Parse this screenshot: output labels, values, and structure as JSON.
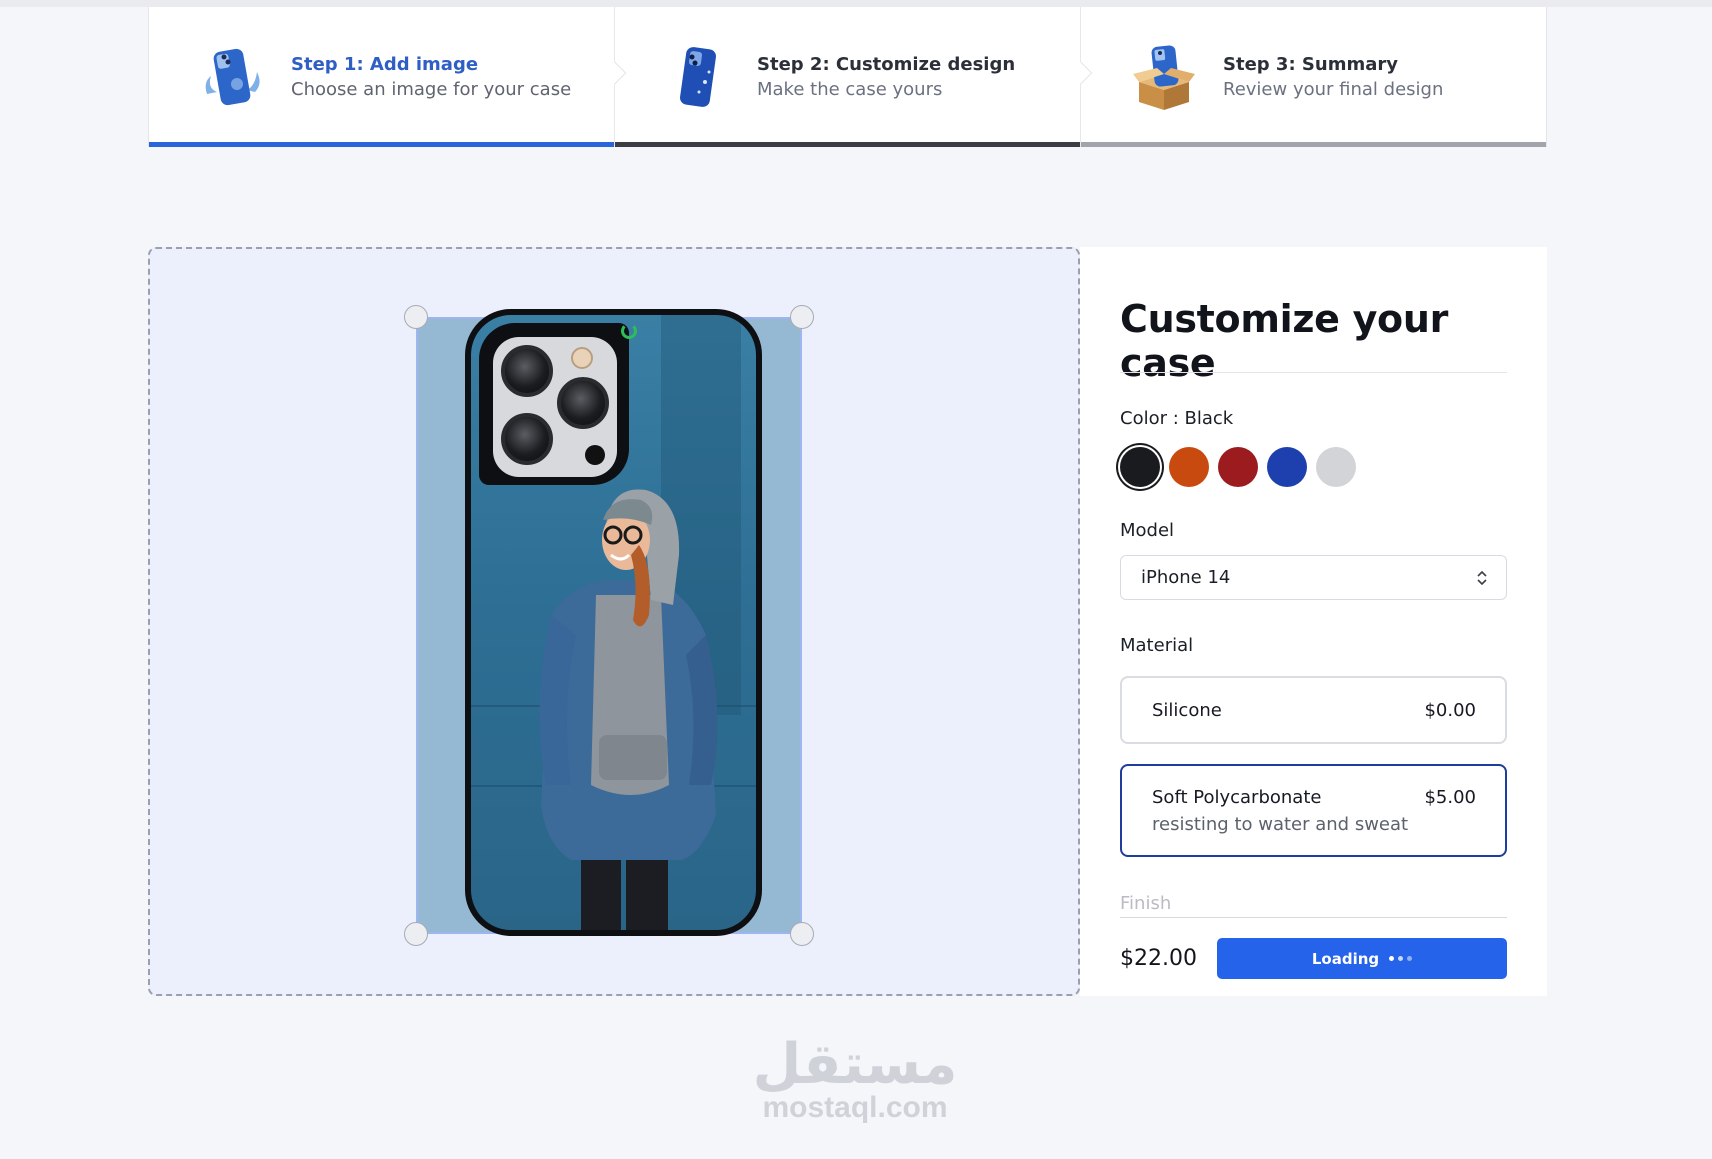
{
  "steps": [
    {
      "title": "Step 1: Add image",
      "subtitle": "Choose an image for your case",
      "state": "active",
      "bar_color": "#2b63d9",
      "icon": "phone-case-splash-icon"
    },
    {
      "title": "Step 2: Customize design",
      "subtitle": "Make the case yours",
      "state": "current",
      "bar_color": "#3a3d44",
      "icon": "phone-case-sparkle-icon"
    },
    {
      "title": "Step 3: Summary",
      "subtitle": "Review your final design",
      "state": "upcoming",
      "bar_color": "#a1a4aa",
      "icon": "phone-case-box-icon"
    }
  ],
  "customize": {
    "title": "Customize your case",
    "color_label": "Color : Black",
    "colors": [
      {
        "name": "Black",
        "hex": "#1a1b1e",
        "selected": true
      },
      {
        "name": "Orange",
        "hex": "#c84a0e",
        "selected": false
      },
      {
        "name": "Red",
        "hex": "#9b1b1f",
        "selected": false
      },
      {
        "name": "Blue",
        "hex": "#1e40af",
        "selected": false
      },
      {
        "name": "Silver",
        "hex": "#d3d4d8",
        "selected": false
      }
    ],
    "model_label": "Model",
    "model_value": "iPhone 14",
    "material_label": "Material",
    "materials": [
      {
        "name": "Silicone",
        "price": "$0.00",
        "description": "",
        "selected": false
      },
      {
        "name": "Soft Polycarbonate",
        "price": "$5.00",
        "description": "resisting to water and sweat",
        "selected": true
      }
    ],
    "finish_label": "Finish",
    "total_price": "$22.00",
    "button_label": "Loading"
  },
  "watermark": {
    "arabic": "مستقل",
    "latin": "mostaql.com"
  }
}
